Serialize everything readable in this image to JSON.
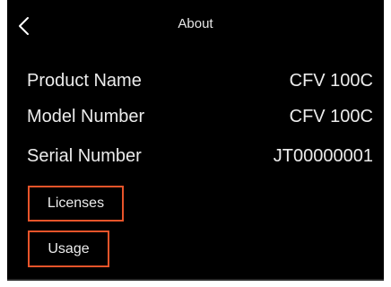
{
  "header": {
    "title": "About",
    "back_icon": "chevron-left-icon"
  },
  "info": [
    {
      "label": "Product Name",
      "value": "CFV 100C"
    },
    {
      "label": "Model Number",
      "value": "CFV 100C"
    },
    {
      "label": "Serial Number",
      "value": "JT00000001"
    }
  ],
  "buttons": {
    "licenses": "Licenses",
    "usage": "Usage"
  },
  "colors": {
    "background": "#000000",
    "text": "#ececec",
    "accent_border": "#e8542a"
  }
}
